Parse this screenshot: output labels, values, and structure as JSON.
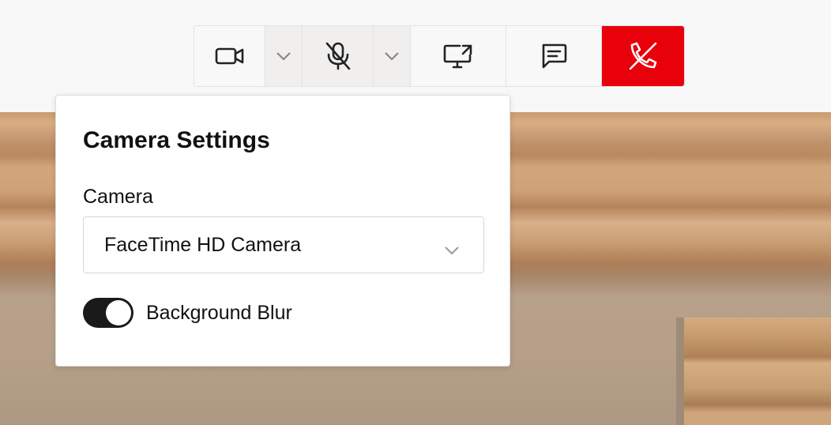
{
  "toolbar": {
    "buttons": [
      {
        "name": "camera-button",
        "icon": "video-camera-icon"
      },
      {
        "name": "camera-options-dropdown",
        "icon": "chevron-down-icon"
      },
      {
        "name": "microphone-button",
        "icon": "microphone-off-icon"
      },
      {
        "name": "microphone-options-dropdown",
        "icon": "chevron-down-icon"
      },
      {
        "name": "share-screen-button",
        "icon": "screen-share-icon"
      },
      {
        "name": "chat-button",
        "icon": "chat-icon"
      },
      {
        "name": "end-call-button",
        "icon": "phone-hangup-icon"
      }
    ],
    "colors": {
      "end_call": "#e8000b",
      "dropdown_bg": "#f0efee"
    }
  },
  "camera_settings": {
    "title": "Camera Settings",
    "camera_label": "Camera",
    "camera_selected": "FaceTime HD Camera",
    "blur_label": "Background Blur",
    "blur_enabled": true
  }
}
